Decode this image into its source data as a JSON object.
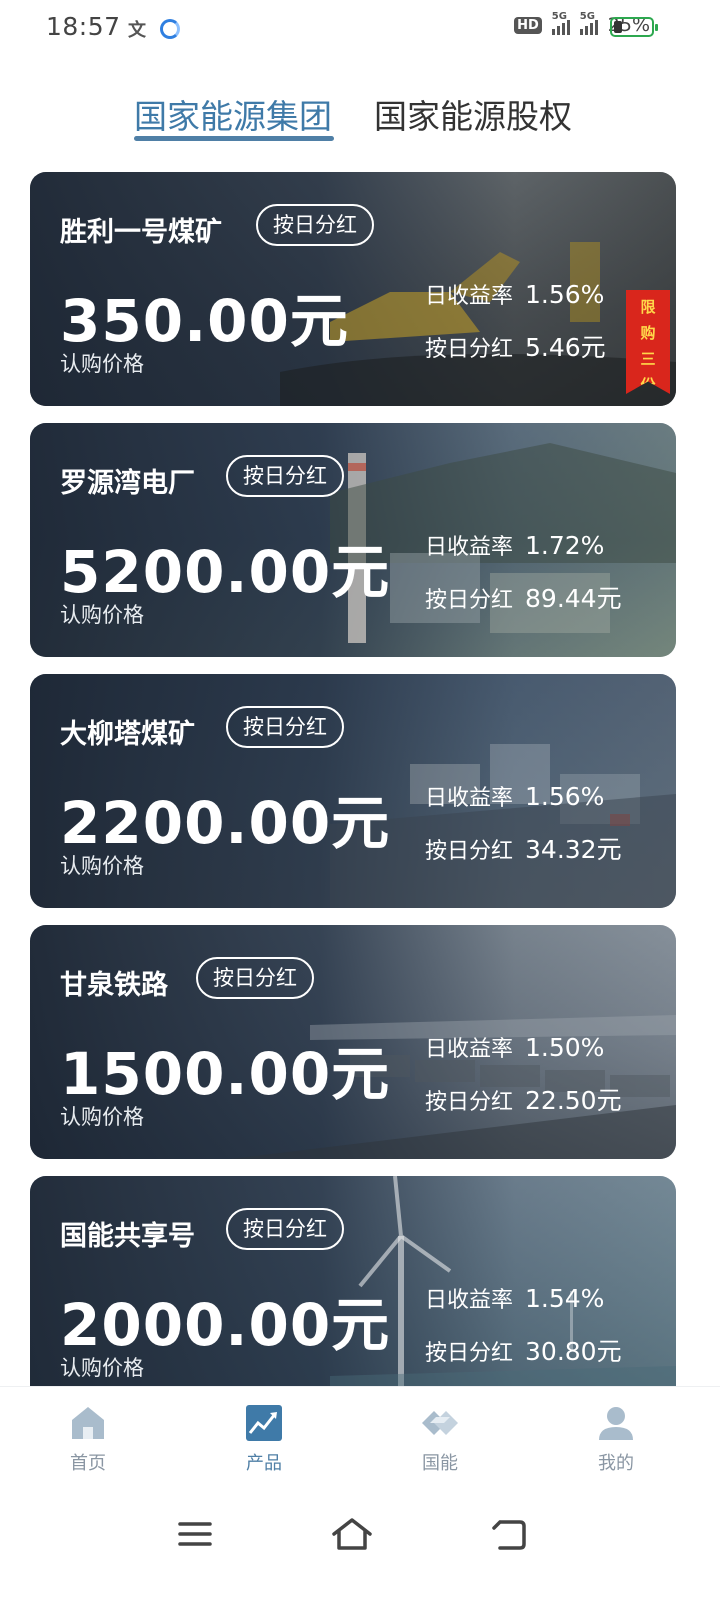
{
  "status_bar": {
    "time": "18:57",
    "network_hd": "HD",
    "signal_1": "5G",
    "signal_2": "5G",
    "battery": "25%"
  },
  "tabs": [
    {
      "label": "国家能源集团",
      "active": true
    },
    {
      "label": "国家能源股权",
      "active": false
    }
  ],
  "products": [
    {
      "name": "胜利一号煤矿",
      "badge": "按日分红",
      "price": "350.00元",
      "price_label": "认购价格",
      "rate_label": "日收益率",
      "rate": "1.56%",
      "dividend_label": "按日分红",
      "dividend": "5.46元",
      "ribbon": [
        "限",
        "购",
        "三",
        "份"
      ]
    },
    {
      "name": "罗源湾电厂",
      "badge": "按日分红",
      "price": "5200.00元",
      "price_label": "认购价格",
      "rate_label": "日收益率",
      "rate": "1.72%",
      "dividend_label": "按日分红",
      "dividend": "89.44元"
    },
    {
      "name": "大柳塔煤矿",
      "badge": "按日分红",
      "price": "2200.00元",
      "price_label": "认购价格",
      "rate_label": "日收益率",
      "rate": "1.56%",
      "dividend_label": "按日分红",
      "dividend": "34.32元"
    },
    {
      "name": "甘泉铁路",
      "badge": "按日分红",
      "price": "1500.00元",
      "price_label": "认购价格",
      "rate_label": "日收益率",
      "rate": "1.50%",
      "dividend_label": "按日分红",
      "dividend": "22.50元"
    },
    {
      "name": "国能共享号",
      "badge": "按日分红",
      "price": "2000.00元",
      "price_label": "认购价格",
      "rate_label": "日收益率",
      "rate": "1.54%",
      "dividend_label": "按日分红",
      "dividend": "30.80元"
    }
  ],
  "bottom_nav": [
    {
      "label": "首页",
      "icon": "home-icon",
      "active": false
    },
    {
      "label": "产品",
      "icon": "chart-trend-icon",
      "active": true
    },
    {
      "label": "国能",
      "icon": "guoneng-logo-icon",
      "active": false
    },
    {
      "label": "我的",
      "icon": "user-icon",
      "active": false
    }
  ],
  "system_nav": [
    "menu-icon",
    "home-outline-icon",
    "back-icon"
  ],
  "colors": {
    "accent": "#4f7fa6",
    "card_overlay": "#2a3646",
    "ribbon": "#d9261c",
    "ribbon_text": "#ffd84a",
    "nav_inactive": "#8a96a3"
  }
}
